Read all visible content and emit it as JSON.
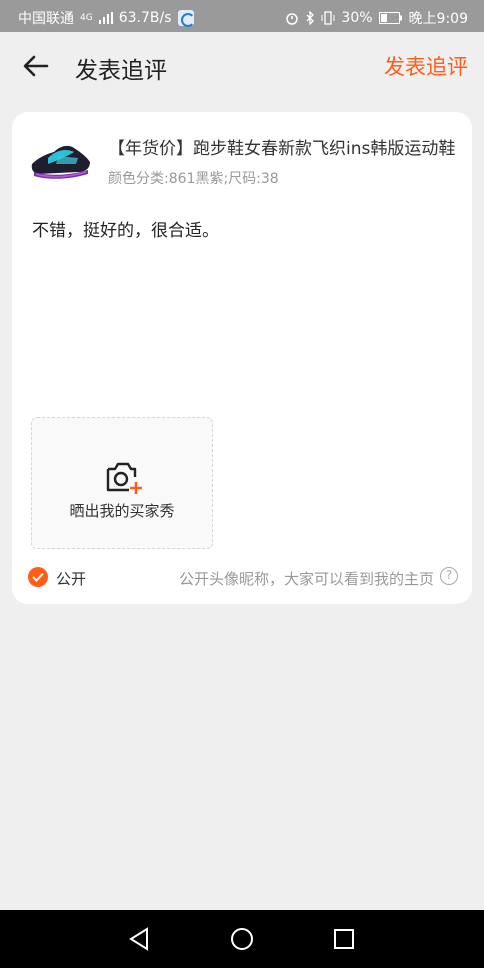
{
  "status_bar": {
    "carrier": "中国联通",
    "network": "4G",
    "speed": "63.7B/s",
    "battery": "30%",
    "time": "晚上9:09"
  },
  "header": {
    "back_icon": "arrow-left-icon",
    "title": "发表追评",
    "action_label": "发表追评",
    "accent_color": "#ff5d19"
  },
  "product": {
    "title": "【年货价】跑步鞋女春新款飞织ins韩版运动鞋",
    "spec": "颜色分类:861黑紫;尺码:38"
  },
  "review": {
    "text": "不错，挺好的，很合适。"
  },
  "photo_upload": {
    "icon": "camera-add-icon",
    "label": "晒出我的买家秀"
  },
  "visibility": {
    "label": "公开",
    "checked": true,
    "note": "公开头像昵称，大家可以看到我的主页",
    "help_icon": "question-circle-icon"
  },
  "nav": {
    "back": "triangle-back-icon",
    "home": "circle-home-icon",
    "recent": "square-recent-icon"
  }
}
